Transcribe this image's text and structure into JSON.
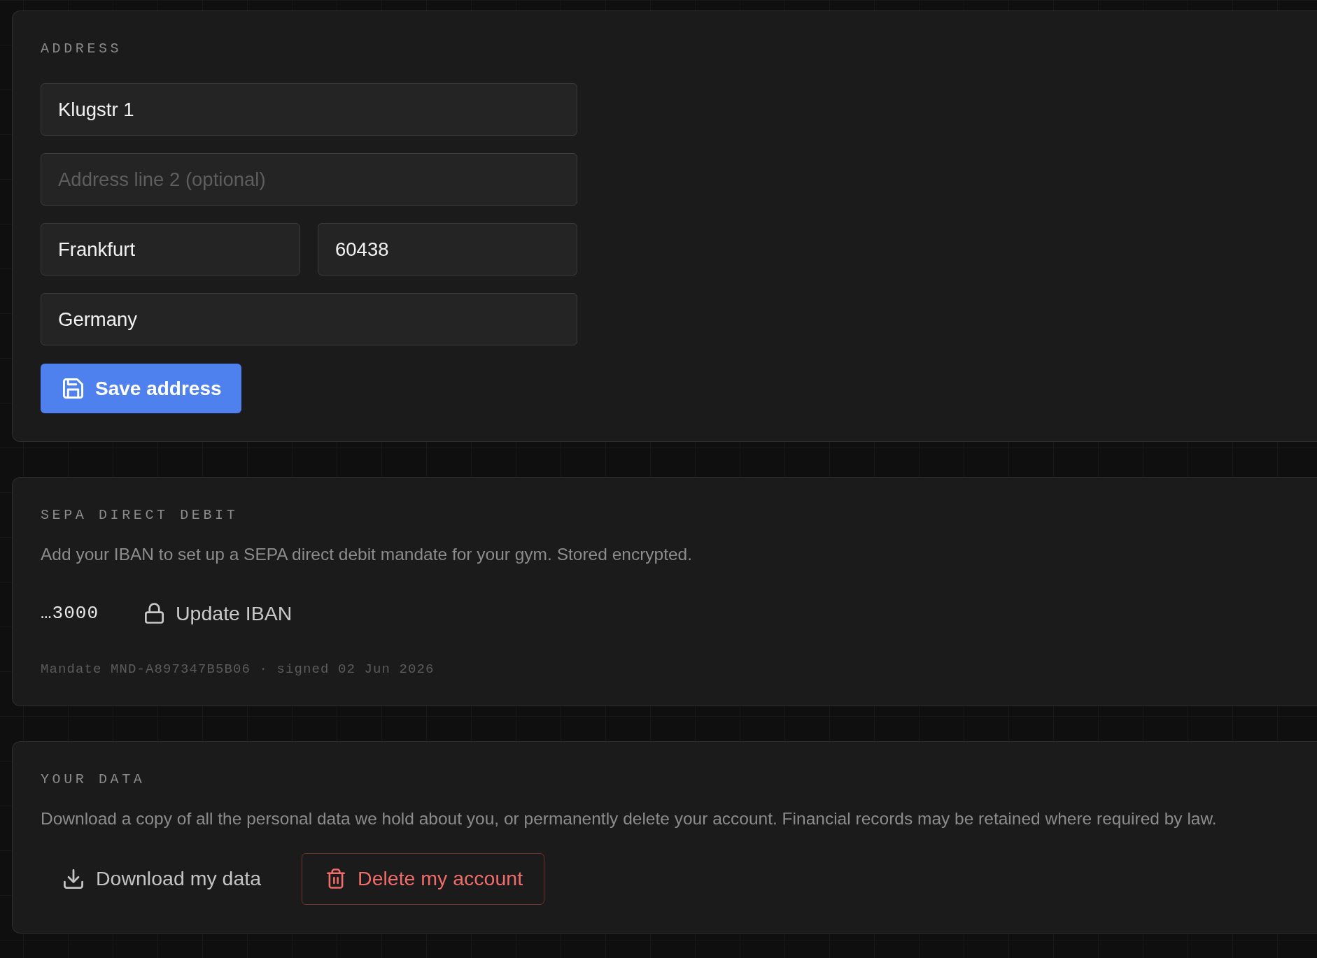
{
  "address": {
    "title": "ADDRESS",
    "street": {
      "value": "Klugstr 1"
    },
    "street_2": {
      "placeholder": "Address line 2 (optional)"
    },
    "city": {
      "value": "Frankfurt"
    },
    "postal_code": {
      "value": "60438"
    },
    "country": {
      "value": "Germany"
    },
    "save_button": {
      "label": "Save address"
    }
  },
  "sepa_direct_debit": {
    "title": "SEPA DIRECT DEBIT",
    "description": "Add your IBAN to set up a SEPA direct debit mandate for your gym. Stored encrypted.",
    "iban_suffix": "…3000",
    "update_button": {
      "label": "Update IBAN"
    },
    "mandate": "Mandate MND-A897347B5B06 · signed 02 Jun 2026"
  },
  "your_data": {
    "title": "YOUR DATA",
    "description": "Download a copy of all the personal data we hold about you, or permanently delete your account. Financial records may be retained where required by law.",
    "download_button": {
      "label": "Download my data"
    },
    "delete_button": {
      "label": "Delete my account"
    }
  }
}
